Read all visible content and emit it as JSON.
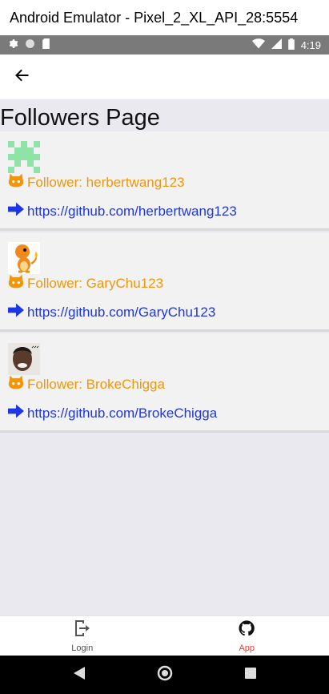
{
  "window": {
    "title": "Android Emulator - Pixel_2_XL_API_28:5554"
  },
  "status_bar": {
    "time": "4:19"
  },
  "header": {
    "back_icon": "arrow-left-icon"
  },
  "page": {
    "title": "Followers Page"
  },
  "followers": [
    {
      "follower_text": "Follower: herbertwang123",
      "url": "https://github.com/herbertwang123",
      "avatar": "green-pixel-identicon"
    },
    {
      "follower_text": "Follower: GaryChu123",
      "url": "https://github.com/GaryChu123",
      "avatar": "charmander-image"
    },
    {
      "follower_text": "Follower: BrokeChigga",
      "url": "https://github.com/BrokeChigga",
      "avatar": "person-photo"
    }
  ],
  "tabs": [
    {
      "label": "Login",
      "icon": "logout-door-icon",
      "color": "#555555"
    },
    {
      "label": "App",
      "icon": "github-cat-icon",
      "color": "#e53935"
    }
  ],
  "colors": {
    "follower_text": "#f0960d",
    "link": "#1f36e3",
    "content_bg": "#e9e9ef",
    "status_bar": "#7a7a7a"
  }
}
